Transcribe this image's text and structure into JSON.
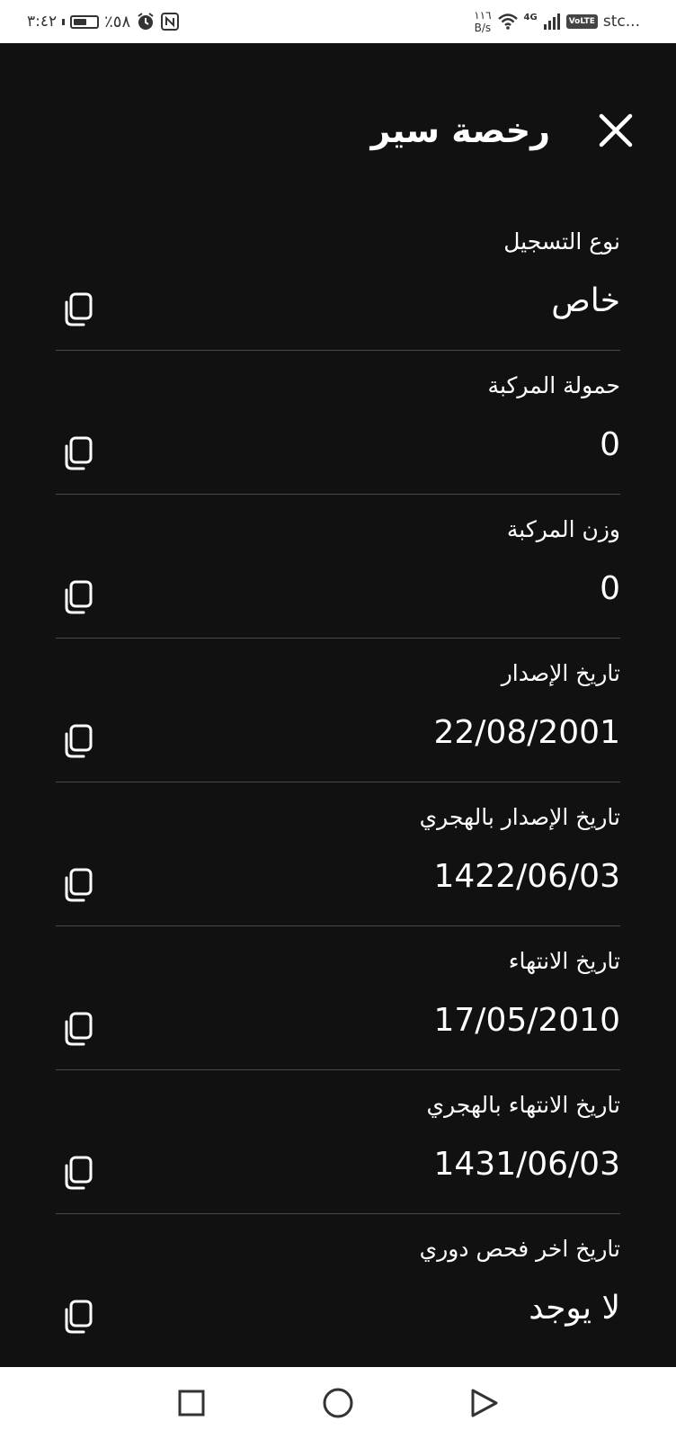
{
  "status_bar": {
    "time": "٣:٤٢",
    "battery_percent": "٪٥٨",
    "battery_level": 0.58,
    "net_speed_value": "١١٦",
    "net_speed_unit": "B/s",
    "network_type": "4G",
    "volte": "VoLTE",
    "carrier": "stc..."
  },
  "header": {
    "title": "رخصة سير"
  },
  "fields": [
    {
      "label": "نوع التسجيل",
      "value": "خاص"
    },
    {
      "label": "حمولة المركبة",
      "value": "0"
    },
    {
      "label": "وزن المركبة",
      "value": "0"
    },
    {
      "label": "تاريخ الإصدار",
      "value": "22/08/2001"
    },
    {
      "label": "تاريخ الإصدار بالهجري",
      "value": "1422/06/03"
    },
    {
      "label": "تاريخ الانتهاء",
      "value": "17/05/2010"
    },
    {
      "label": "تاريخ الانتهاء بالهجري",
      "value": "1431/06/03"
    },
    {
      "label": "تاريخ اخر فحص دوري",
      "value": "لا يوجد"
    }
  ],
  "icons": {
    "close": "close-icon",
    "copy": "copy-icon",
    "nav_recents": "square-icon",
    "nav_home": "circle-icon",
    "nav_back": "triangle-back-icon"
  },
  "colors": {
    "background": "#111111",
    "text": "#ffffff",
    "divider": "#4a4a4a",
    "system_bars": "#ffffff"
  }
}
